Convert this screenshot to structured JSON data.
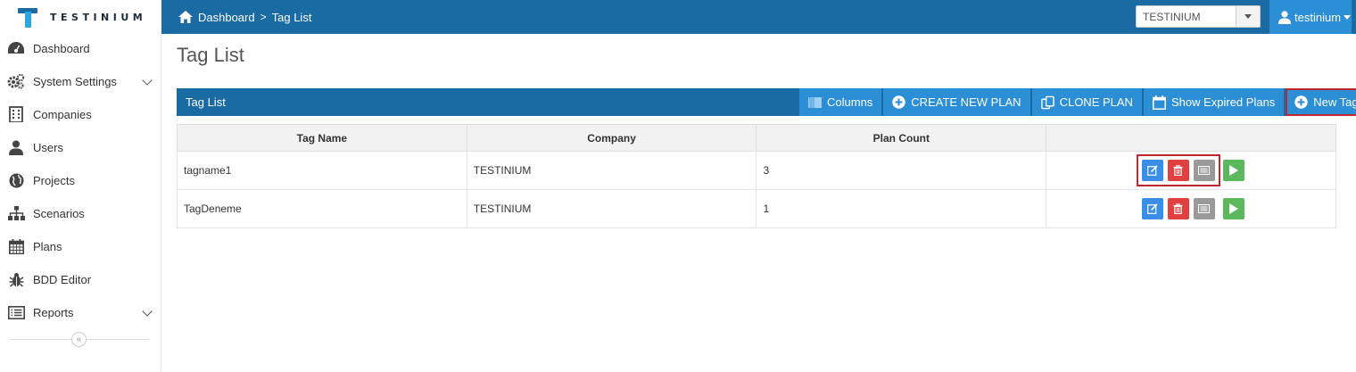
{
  "app": {
    "logo_text": "TESTINIUM"
  },
  "header": {
    "breadcrumb": [
      "Dashboard",
      "Tag List"
    ],
    "breadcrumb_sep": ">",
    "company_select": "TESTINIUM",
    "user_name": "testinium"
  },
  "sidebar": {
    "items": [
      {
        "label": "Dashboard",
        "icon": "dashboard-icon",
        "expandable": false
      },
      {
        "label": "System Settings",
        "icon": "cogs-icon",
        "expandable": true
      },
      {
        "label": "Companies",
        "icon": "building-icon",
        "expandable": false
      },
      {
        "label": "Users",
        "icon": "user-icon",
        "expandable": false
      },
      {
        "label": "Projects",
        "icon": "globe-icon",
        "expandable": false
      },
      {
        "label": "Scenarios",
        "icon": "sitemap-icon",
        "expandable": false
      },
      {
        "label": "Plans",
        "icon": "calendar-icon",
        "expandable": false
      },
      {
        "label": "BDD Editor",
        "icon": "bug-icon",
        "expandable": false
      },
      {
        "label": "Reports",
        "icon": "list-icon",
        "expandable": true
      }
    ],
    "collapse_glyph": "«"
  },
  "main": {
    "page_title": "Tag List",
    "panel_title": "Tag List",
    "toolbar": {
      "columns": "Columns",
      "create_plan": "CREATE NEW PLAN",
      "clone_plan": "CLONE PLAN",
      "show_expired": "Show Expired Plans",
      "new_tag": "New Tag"
    },
    "table": {
      "headers": [
        "Tag Name",
        "Company",
        "Plan Count",
        ""
      ],
      "rows": [
        {
          "tag_name": "tagname1",
          "company": "TESTINIUM",
          "plan_count": "3"
        },
        {
          "tag_name": "TagDeneme",
          "company": "TESTINIUM",
          "plan_count": "1"
        }
      ]
    }
  },
  "colors": {
    "header_bg": "#1a6aa3",
    "button_bg": "#2c8fd6",
    "highlight": "#c0272d",
    "edit": "#3a8ee6",
    "delete": "#e04040",
    "list": "#9a9a9a",
    "run": "#5cb85c"
  }
}
